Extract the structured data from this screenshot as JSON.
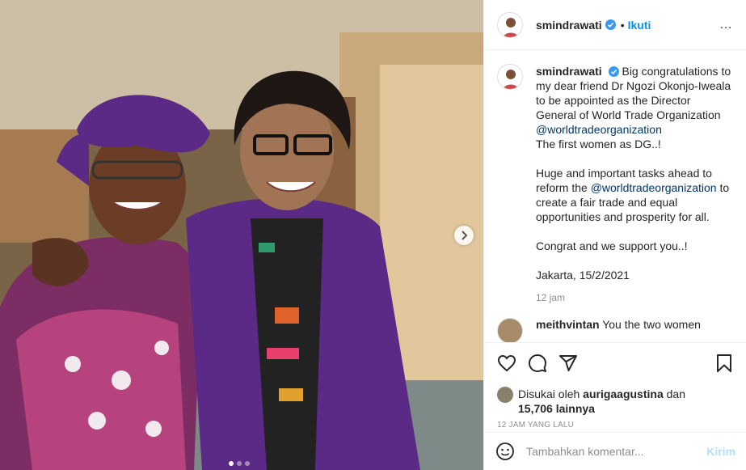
{
  "post": {
    "username": "smindrawati",
    "separator": "•",
    "follow_label": "Ikuti",
    "menu_label": "…"
  },
  "caption": {
    "username": "smindrawati",
    "line1": "Big congratulations to my dear friend Dr Ngozi Okonjo-Iweala to be appointed as the Director General of World Trade Organization",
    "mention1": "@worldtradeorganization",
    "line2": "The first women as DG..!",
    "line3_a": "Huge and important tasks ahead to reform the",
    "mention2": "@worldtradeorganization",
    "line3_b": "to create a fair trade and equal opportunities and prosperity for all.",
    "line4": "Congrat and we support you..!",
    "line5": "Jakarta, 15/2/2021",
    "time": "12 jam"
  },
  "comment": {
    "username": "meithvintan",
    "text": "You the two women"
  },
  "likes": {
    "prefix": "Disukai oleh",
    "user": "aurigaagustina",
    "conj": "dan",
    "count": "15,706 lainnya"
  },
  "posted_time": "12 JAM YANG LALU",
  "add_comment": {
    "placeholder": "Tambahkan komentar...",
    "send_label": "Kirim"
  },
  "icons": {
    "verified": "verified-badge-icon",
    "like": "heart-icon",
    "comment": "comment-bubble-icon",
    "share": "paper-plane-icon",
    "save": "bookmark-icon",
    "next": "chevron-right-icon",
    "emoji": "smiley-icon"
  },
  "carousel": {
    "total": 3,
    "active_index": 0
  },
  "colors": {
    "link_blue": "#0095f6",
    "mention_blue": "#00376b",
    "verified_blue": "#3897f0"
  }
}
